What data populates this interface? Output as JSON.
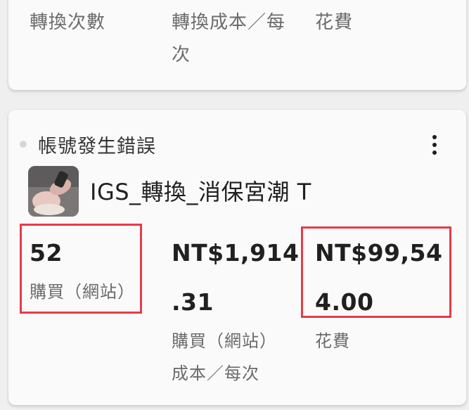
{
  "top_card": {
    "conversions_label": "轉換次數",
    "cost_per_label_line1": "轉換成本／每",
    "cost_per_label_line2": "次",
    "spend_label": "花費"
  },
  "ad_card": {
    "status": "帳號發生錯誤",
    "ad_name": "IGS_轉換_消保宮潮 T",
    "metrics": {
      "purchases": {
        "value": "52",
        "label": "購買（網站）"
      },
      "cost_per_purchase": {
        "value_line1": "NT$1,914",
        "value_line2": ".31",
        "label_line1": "購買（網站）",
        "label_line2": "成本／每次"
      },
      "spend": {
        "value_line1": "NT$99,54",
        "value_line2": "4.00",
        "label": "花費"
      }
    }
  },
  "colors": {
    "highlight": "#e53c48",
    "status_dot": "#d7d7d7",
    "background": "#efefef"
  },
  "icons": {
    "status": "status-dot-icon",
    "menu": "more-vertical-icon"
  }
}
